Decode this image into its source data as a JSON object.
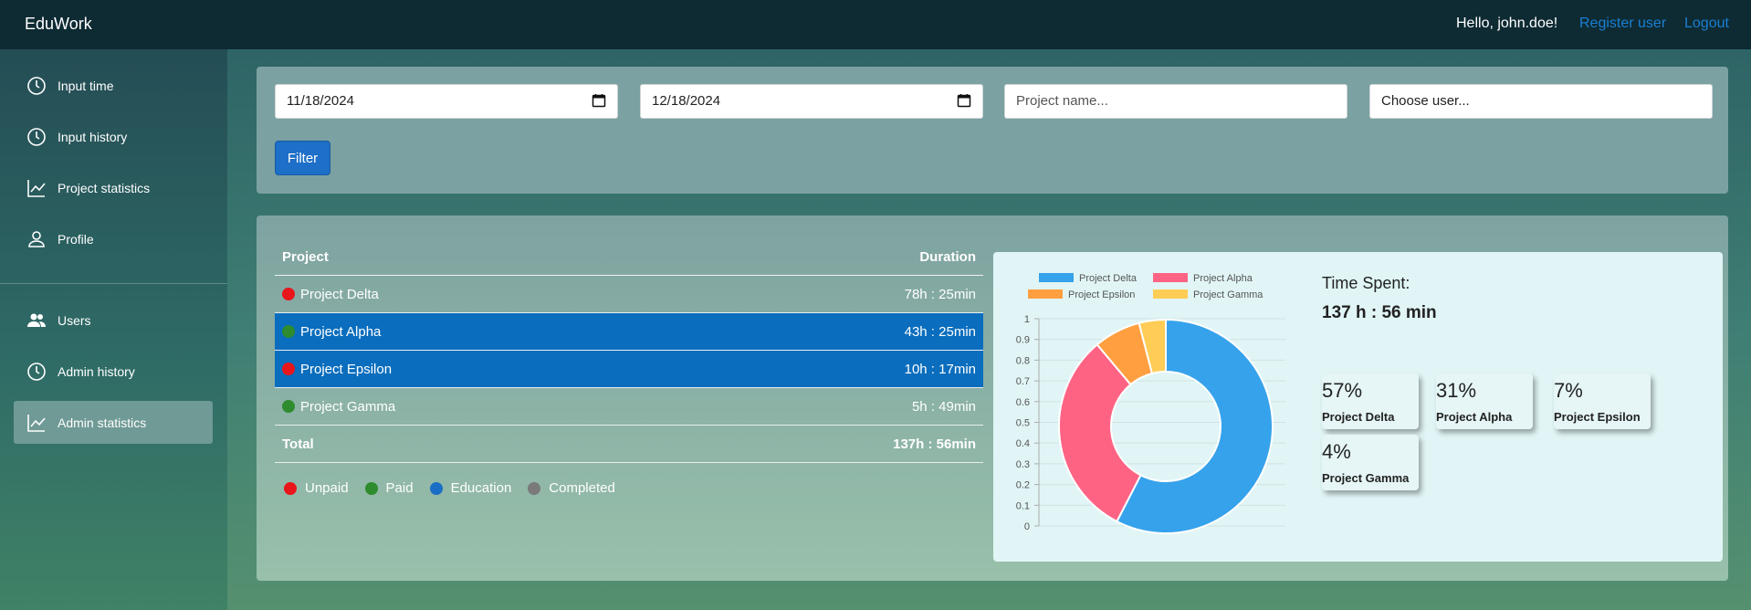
{
  "header": {
    "brand": "EduWork",
    "greeting": "Hello, john.doe!",
    "register_label": "Register user",
    "logout_label": "Logout"
  },
  "sidebar": {
    "items": [
      {
        "label": "Input time",
        "icon": "clock-icon"
      },
      {
        "label": "Input history",
        "icon": "history-icon"
      },
      {
        "label": "Project statistics",
        "icon": "chart-line-icon"
      },
      {
        "label": "Profile",
        "icon": "user-icon"
      },
      {
        "label": "Users",
        "icon": "users-icon"
      },
      {
        "label": "Admin history",
        "icon": "history-icon"
      },
      {
        "label": "Admin statistics",
        "icon": "chart-line-icon",
        "active": true
      }
    ]
  },
  "filter": {
    "date_from": "11/18/2024",
    "date_to": "12/18/2024",
    "project_placeholder": "Project name...",
    "user_placeholder": "Choose user...",
    "filter_label": "Filter"
  },
  "table": {
    "headers": {
      "project": "Project",
      "duration": "Duration"
    },
    "rows": [
      {
        "name": "Project Delta",
        "duration": "78h : 25min",
        "status_color": "#e8161b"
      },
      {
        "name": "Project Alpha",
        "duration": "43h : 25min",
        "status_color": "#2e8b2e",
        "selected": true
      },
      {
        "name": "Project Epsilon",
        "duration": "10h : 17min",
        "status_color": "#e8161b",
        "selected": true
      },
      {
        "name": "Project Gamma",
        "duration": "5h : 49min",
        "status_color": "#2e8b2e"
      }
    ],
    "total": {
      "label": "Total",
      "duration": "137h : 56min"
    }
  },
  "legend": [
    {
      "label": "Unpaid",
      "color": "#e8161b"
    },
    {
      "label": "Paid",
      "color": "#2e8b2e"
    },
    {
      "label": "Education",
      "color": "#1a6fc4"
    },
    {
      "label": "Completed",
      "color": "#7a7a7a"
    }
  ],
  "summary": {
    "time_spent_label": "Time Spent:",
    "time_spent_value": "137 h : 56 min",
    "stats": [
      {
        "pct": "57%",
        "name": "Project Delta"
      },
      {
        "pct": "31%",
        "name": "Project Alpha"
      },
      {
        "pct": "7%",
        "name": "Project Epsilon"
      },
      {
        "pct": "4%",
        "name": "Project Gamma"
      }
    ]
  },
  "chart_data": {
    "type": "pie",
    "variant": "doughnut",
    "categories": [
      "Project Delta",
      "Project Alpha",
      "Project Epsilon",
      "Project Gamma"
    ],
    "values": [
      57,
      31,
      7,
      4
    ],
    "colors": [
      "#36a2eb",
      "#ff6384",
      "#ff9f40",
      "#ffcd56"
    ],
    "y_ticks": [
      "0",
      "0.1",
      "0.2",
      "0.3",
      "0.4",
      "0.5",
      "0.6",
      "0.7",
      "0.8",
      "0.9",
      "1"
    ],
    "ylim": [
      0,
      1
    ],
    "grid": true,
    "legend_position": "top"
  }
}
